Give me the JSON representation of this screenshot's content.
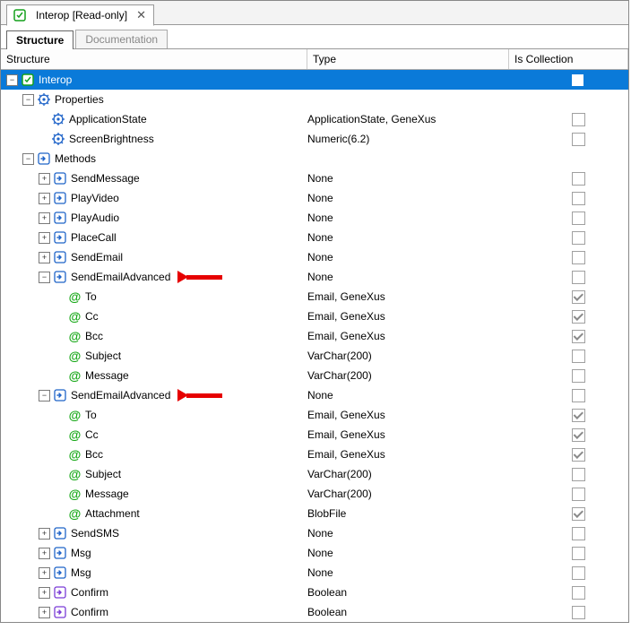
{
  "fileTab": {
    "title": "Interop [Read-only]"
  },
  "subTabs": {
    "structure": "Structure",
    "documentation": "Documentation"
  },
  "headers": {
    "name": "Structure",
    "type": "Type",
    "collection": "Is Collection"
  },
  "icons": {
    "object": "object",
    "gear": "gear",
    "methods": "methods",
    "method": "method",
    "at": "at",
    "confirm": "confirm"
  },
  "rows": [
    {
      "depth": 0,
      "toggle": "minus",
      "icon": "object",
      "name": "Interop",
      "type": "",
      "chk": "none",
      "selected": true
    },
    {
      "depth": 1,
      "toggle": "minus",
      "icon": "gear",
      "name": "Properties",
      "type": "",
      "chk": "none"
    },
    {
      "depth": 2,
      "toggle": "none",
      "icon": "gear",
      "name": "ApplicationState",
      "type": "ApplicationState, GeneXus",
      "chk": "off"
    },
    {
      "depth": 2,
      "toggle": "none",
      "icon": "gear",
      "name": "ScreenBrightness",
      "type": "Numeric(6.2)",
      "chk": "off"
    },
    {
      "depth": 1,
      "toggle": "minus",
      "icon": "methods",
      "name": "Methods",
      "type": "",
      "chk": "none"
    },
    {
      "depth": 2,
      "toggle": "plus",
      "icon": "method",
      "name": "SendMessage",
      "type": "None",
      "chk": "off"
    },
    {
      "depth": 2,
      "toggle": "plus",
      "icon": "method",
      "name": "PlayVideo",
      "type": "None",
      "chk": "off"
    },
    {
      "depth": 2,
      "toggle": "plus",
      "icon": "method",
      "name": "PlayAudio",
      "type": "None",
      "chk": "off"
    },
    {
      "depth": 2,
      "toggle": "plus",
      "icon": "method",
      "name": "PlaceCall",
      "type": "None",
      "chk": "off"
    },
    {
      "depth": 2,
      "toggle": "plus",
      "icon": "method",
      "name": "SendEmail",
      "type": "None",
      "chk": "off"
    },
    {
      "depth": 2,
      "toggle": "minus",
      "icon": "method",
      "name": "SendEmailAdvanced",
      "type": "None",
      "chk": "off",
      "arrow": true
    },
    {
      "depth": 3,
      "toggle": "none",
      "icon": "at",
      "name": "To",
      "type": "Email, GeneXus",
      "chk": "on"
    },
    {
      "depth": 3,
      "toggle": "none",
      "icon": "at",
      "name": "Cc",
      "type": "Email, GeneXus",
      "chk": "on"
    },
    {
      "depth": 3,
      "toggle": "none",
      "icon": "at",
      "name": "Bcc",
      "type": "Email, GeneXus",
      "chk": "on"
    },
    {
      "depth": 3,
      "toggle": "none",
      "icon": "at",
      "name": "Subject",
      "type": "VarChar(200)",
      "chk": "off"
    },
    {
      "depth": 3,
      "toggle": "none",
      "icon": "at",
      "name": "Message",
      "type": "VarChar(200)",
      "chk": "off"
    },
    {
      "depth": 2,
      "toggle": "minus",
      "icon": "method",
      "name": "SendEmailAdvanced",
      "type": "None",
      "chk": "off",
      "arrow": true
    },
    {
      "depth": 3,
      "toggle": "none",
      "icon": "at",
      "name": "To",
      "type": "Email, GeneXus",
      "chk": "on"
    },
    {
      "depth": 3,
      "toggle": "none",
      "icon": "at",
      "name": "Cc",
      "type": "Email, GeneXus",
      "chk": "on"
    },
    {
      "depth": 3,
      "toggle": "none",
      "icon": "at",
      "name": "Bcc",
      "type": "Email, GeneXus",
      "chk": "on"
    },
    {
      "depth": 3,
      "toggle": "none",
      "icon": "at",
      "name": "Subject",
      "type": "VarChar(200)",
      "chk": "off"
    },
    {
      "depth": 3,
      "toggle": "none",
      "icon": "at",
      "name": "Message",
      "type": "VarChar(200)",
      "chk": "off"
    },
    {
      "depth": 3,
      "toggle": "none",
      "icon": "at",
      "name": "Attachment",
      "type": "BlobFile",
      "chk": "on"
    },
    {
      "depth": 2,
      "toggle": "plus",
      "icon": "method",
      "name": "SendSMS",
      "type": "None",
      "chk": "off"
    },
    {
      "depth": 2,
      "toggle": "plus",
      "icon": "method",
      "name": "Msg",
      "type": "None",
      "chk": "off"
    },
    {
      "depth": 2,
      "toggle": "plus",
      "icon": "method",
      "name": "Msg",
      "type": "None",
      "chk": "off"
    },
    {
      "depth": 2,
      "toggle": "plus",
      "icon": "confirm",
      "name": "Confirm",
      "type": "Boolean",
      "chk": "off"
    },
    {
      "depth": 2,
      "toggle": "plus",
      "icon": "confirm",
      "name": "Confirm",
      "type": "Boolean",
      "chk": "off"
    }
  ]
}
